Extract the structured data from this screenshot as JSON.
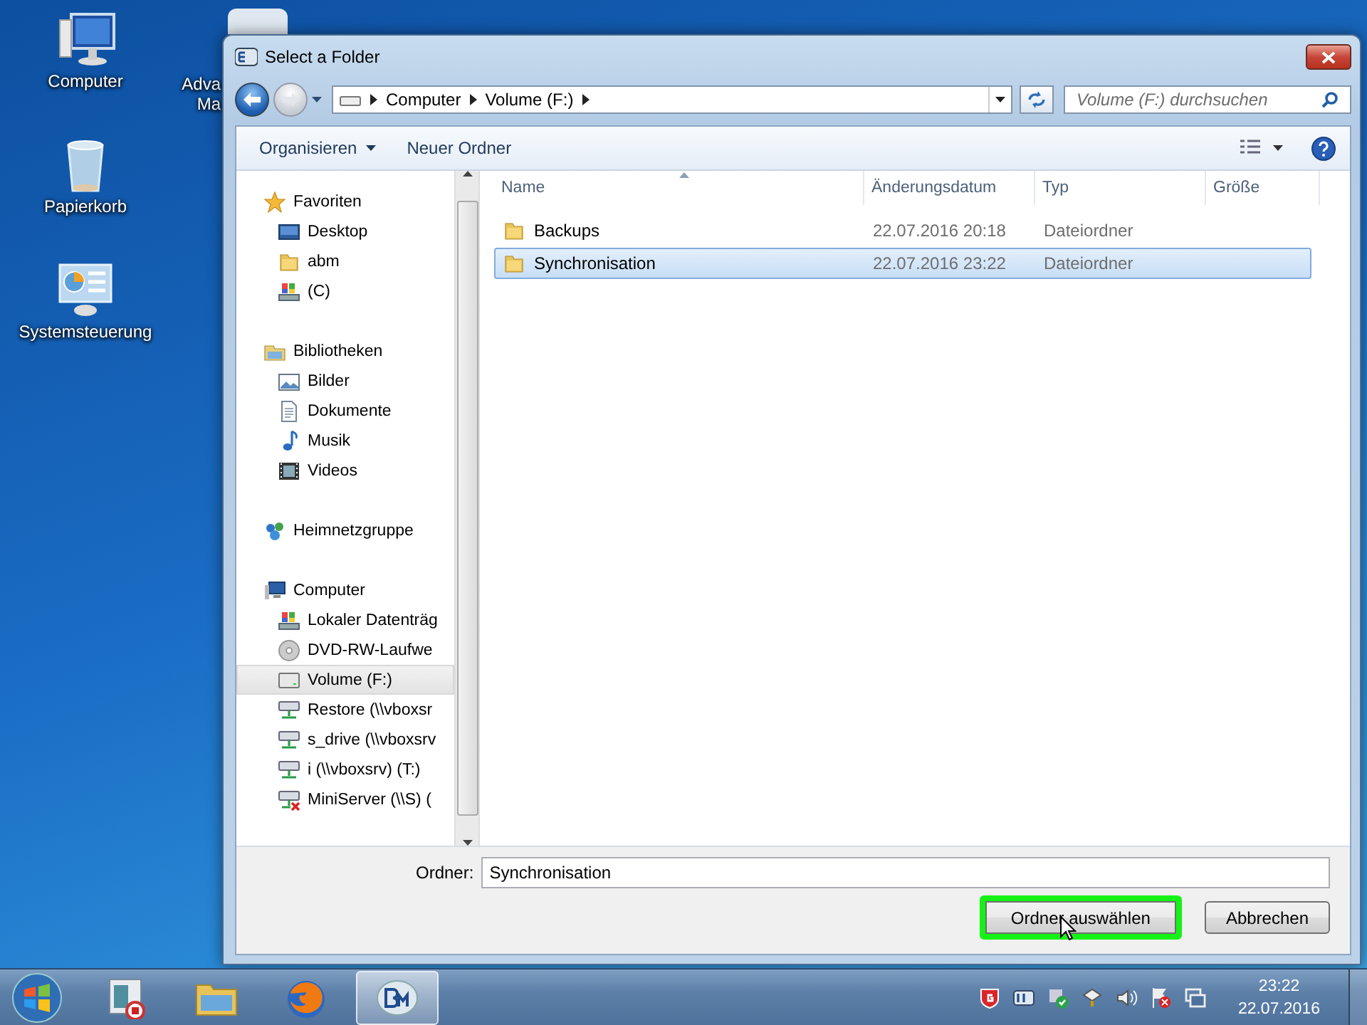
{
  "desktop_icons": [
    {
      "kind": "computer",
      "label_lines": [
        "Computer"
      ]
    },
    {
      "kind": "recycle",
      "label_lines": [
        "Papierkorb"
      ]
    },
    {
      "kind": "control",
      "label_lines": [
        "Systemsteuerung"
      ]
    },
    {
      "kind": "app",
      "label_lines": [
        "Adva",
        "Ma"
      ]
    }
  ],
  "dialog": {
    "title": "Select a Folder",
    "breadcrumb": [
      "Computer",
      "Volume (F:)"
    ],
    "search": {
      "placeholder": "Volume (F:) durchsuchen"
    },
    "toolbar": [
      {
        "label": "Organisieren",
        "kind": "menu"
      },
      {
        "label": "Neuer Ordner",
        "kind": "button"
      }
    ],
    "nav": [
      {
        "label": "Favoriten",
        "kind": "star",
        "selected": false,
        "children": [
          {
            "label": "Desktop",
            "kind": "desktop",
            "selected": false
          },
          {
            "label": "abm",
            "kind": "folder",
            "selected": false
          },
          {
            "label": "(C)",
            "kind": "systemdrive",
            "selected": false
          }
        ]
      },
      {
        "label": "Bibliotheken",
        "kind": "library",
        "selected": false,
        "children": [
          {
            "label": "Bilder",
            "kind": "pictures",
            "selected": false
          },
          {
            "label": "Dokumente",
            "kind": "document",
            "selected": false
          },
          {
            "label": "Musik",
            "kind": "music",
            "selected": false
          },
          {
            "label": "Videos",
            "kind": "video",
            "selected": false
          }
        ]
      },
      {
        "label": "Heimnetzgruppe",
        "kind": "homegroup",
        "selected": false
      },
      {
        "label": "Computer",
        "kind": "computer",
        "selected": false,
        "children": [
          {
            "label": "Lokaler Datenträg",
            "kind": "systemdrive",
            "selected": false
          },
          {
            "label": "DVD-RW-Laufwe",
            "kind": "disc",
            "selected": false
          },
          {
            "label": "Volume (F:)",
            "kind": "drive",
            "selected": true
          },
          {
            "label": "Restore (\\\\vboxsr",
            "kind": "netdrive",
            "selected": false
          },
          {
            "label": "s_drive (\\\\vboxsrv",
            "kind": "netdrive",
            "selected": false
          },
          {
            "label": "i (\\\\vboxsrv) (T:)",
            "kind": "netdrive",
            "selected": false
          },
          {
            "label": "MiniServer (\\\\S) (",
            "kind": "netdrive-offline",
            "selected": false
          }
        ]
      }
    ],
    "columns": [
      {
        "label": "Name",
        "sorted": true
      },
      {
        "label": "Änderungsdatum",
        "sorted": false
      },
      {
        "label": "Typ",
        "sorted": false
      },
      {
        "label": "Größe",
        "sorted": false
      }
    ],
    "rows": [
      {
        "name": "Backups",
        "date": "22.07.2016 20:18",
        "type": "Dateiordner",
        "selected": false
      },
      {
        "name": "Synchronisation",
        "date": "22.07.2016 23:22",
        "type": "Dateiordner",
        "selected": true
      }
    ],
    "folder_field": {
      "label": "Ordner:",
      "value": "Synchronisation"
    },
    "buttons": [
      {
        "label": "Ordner auswählen",
        "highlighted": true
      },
      {
        "label": "Abbrechen",
        "highlighted": false
      }
    ]
  },
  "taskbar": {
    "apps": [
      {
        "kind": "media",
        "selected": false
      },
      {
        "kind": "explorer",
        "selected": false
      },
      {
        "kind": "browser",
        "selected": false
      },
      {
        "kind": "bm",
        "selected": true
      }
    ],
    "clock": {
      "time": "23:22",
      "date": "22.07.2016"
    }
  }
}
